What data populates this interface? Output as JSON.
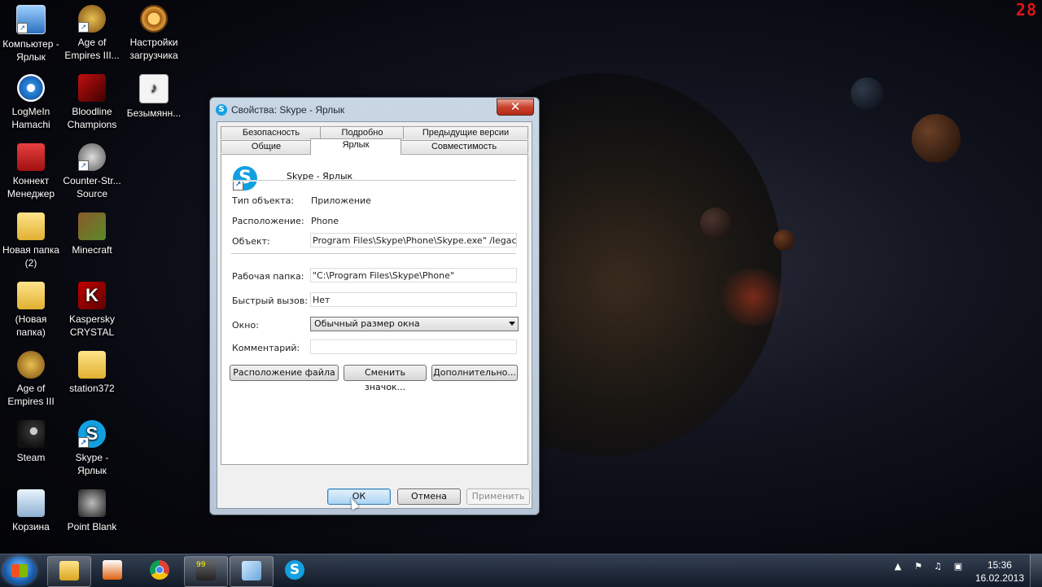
{
  "overlay": {
    "counter": "28"
  },
  "desktop": {
    "icons": [
      {
        "label": "Компьютер - Ярлык",
        "icon": "computer-icon"
      },
      {
        "label": "Age of Empires III...",
        "icon": "age-of-empires-icon"
      },
      {
        "label": "Настройки загрузчика",
        "icon": "settings-gear-icon"
      },
      {
        "label": "LogMeIn Hamachi",
        "icon": "hamachi-icon"
      },
      {
        "label": "Bloodline Champions",
        "icon": "bloodline-icon"
      },
      {
        "label": "Безымянн...",
        "icon": "wma-file-icon"
      },
      {
        "label": "Коннект Менеджер",
        "icon": "connect-manager-icon"
      },
      {
        "label": "Counter-Str... Source",
        "icon": "counter-strike-icon"
      },
      {
        "label": "Новая папка (2)",
        "icon": "folder-icon"
      },
      {
        "label": "Minecraft",
        "icon": "minecraft-icon"
      },
      {
        "label": "(Новая папка)",
        "icon": "folder-icon"
      },
      {
        "label": "Kaspersky CRYSTAL",
        "icon": "kaspersky-icon"
      },
      {
        "label": "Age of Empires III",
        "icon": "age-of-empires-icon"
      },
      {
        "label": "station372",
        "icon": "folder-icon"
      },
      {
        "label": "Steam",
        "icon": "steam-icon"
      },
      {
        "label": "Skype - Ярлык",
        "icon": "skype-icon"
      },
      {
        "label": "Корзина",
        "icon": "recycle-bin-icon"
      },
      {
        "label": "Point Blank",
        "icon": "point-blank-icon"
      }
    ]
  },
  "dialog": {
    "title": "Свойства: Skype - Ярлык",
    "close_glyph": "✕",
    "tabs_back": [
      "Безопасность",
      "Подробно",
      "Предыдущие версии"
    ],
    "tabs_front": [
      "Общие",
      "Ярлык",
      "Совместимость"
    ],
    "active_tab": "Ярлык",
    "shortcut_name": "Skype - Ярлык",
    "type_label": "Тип объекта:",
    "type_value": "Приложение",
    "location_label": "Расположение:",
    "location_value": "Phone",
    "target_label": "Объект:",
    "target_value": "Program Files\\Skype\\Phone\\Skype.exe\" /legacylogin",
    "startin_label": "Рабочая папка:",
    "startin_value": "\"C:\\Program Files\\Skype\\Phone\"",
    "hotkey_label": "Быстрый вызов:",
    "hotkey_value": "Нет",
    "run_label": "Окно:",
    "run_value": "Обычный размер окна",
    "comment_label": "Комментарий:",
    "comment_value": "",
    "btn_open_location": "Расположение файла",
    "btn_change_icon": "Сменить значок...",
    "btn_advanced": "Дополнительно...",
    "btn_ok": "ОК",
    "btn_cancel": "Отмена",
    "btn_apply": "Применить"
  },
  "taskbar": {
    "time": "15:36",
    "date": "16.02.2013",
    "bb_badge": "99"
  }
}
